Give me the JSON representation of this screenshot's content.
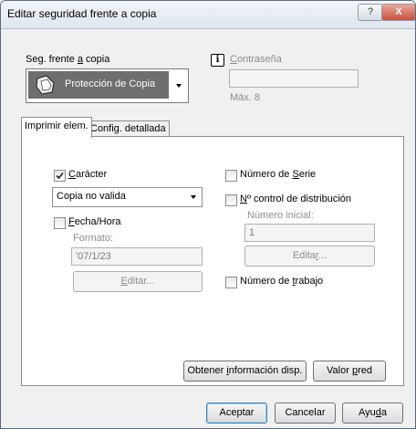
{
  "window": {
    "title": "Editar seguridad frente a copia",
    "help_label": "?",
    "close_label": "X"
  },
  "copy_guard": {
    "label_pre": "Seg. frente ",
    "label_key": "a",
    "label_post": " copia",
    "selected_value": "Protección de Copia"
  },
  "password": {
    "info_icon": "i",
    "label_key": "C",
    "label_post": "ontraseña",
    "value": "",
    "max_hint": "Máx. 8"
  },
  "tabs": [
    {
      "label": "Imprimir elem."
    },
    {
      "label": "Config. detallada"
    }
  ],
  "print_items": {
    "character": {
      "checked": true,
      "label_key": "C",
      "label_post": "arácter",
      "dropdown_value": "Copia no valida"
    },
    "datetime": {
      "checked": false,
      "label_key": "F",
      "label_post": "echa/Hora",
      "format_label": "Formato:",
      "format_value": "'07/1/23",
      "edit_key": "E",
      "edit_post": "ditar..."
    },
    "serial": {
      "checked": false,
      "label_pre": "Número de ",
      "label_key": "S",
      "label_post": "erie"
    },
    "distribution": {
      "checked": false,
      "label_key": "N",
      "label_post": "º control de distribución",
      "initial_label": "Número inicial:",
      "initial_value": "1",
      "edit_pre": "Edita",
      "edit_key": "r",
      "edit_post": "..."
    },
    "job": {
      "checked": false,
      "label_pre": "Número de ",
      "label_key": "t",
      "label_post": "rabajo"
    }
  },
  "panel_buttons": {
    "info_pre": "Obtener ",
    "info_key": "i",
    "info_post": "nformación disp.",
    "default_pre": "Valor ",
    "default_key": "p",
    "default_post": "red"
  },
  "footer": {
    "ok": "Aceptar",
    "cancel": "Cancelar",
    "help_pre": "Ayu",
    "help_key": "d",
    "help_post": "a"
  }
}
